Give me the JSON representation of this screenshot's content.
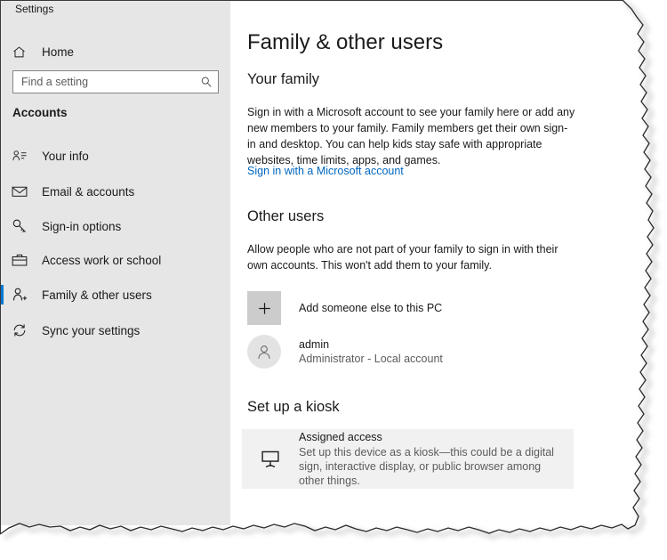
{
  "window": {
    "title": "Settings"
  },
  "sidebar": {
    "home": {
      "label": "Home",
      "icon": "home-icon"
    },
    "search": {
      "placeholder": "Find a setting",
      "value": "",
      "icon": "search-icon"
    },
    "group_label": "Accounts",
    "accent_color": "#0078d4",
    "background_color": "#e6e6e6",
    "items": [
      {
        "label": "Your info",
        "icon": "person-lines-icon",
        "selected": false
      },
      {
        "label": "Email & accounts",
        "icon": "envelope-icon",
        "selected": false
      },
      {
        "label": "Sign-in options",
        "icon": "key-icon",
        "selected": false
      },
      {
        "label": "Access work or school",
        "icon": "briefcase-icon",
        "selected": false
      },
      {
        "label": "Family & other users",
        "icon": "person-add-icon",
        "selected": true
      },
      {
        "label": "Sync your settings",
        "icon": "sync-icon",
        "selected": false
      }
    ]
  },
  "main": {
    "page_title": "Family & other users",
    "sections": {
      "family": {
        "heading": "Your family",
        "paragraph": "Sign in with a Microsoft account to see your family here or add any new members to your family. Family members get their own sign-in and desktop. You can help kids stay safe with appropriate websites, time limits, apps, and games.",
        "link_label": "Sign in with a Microsoft account",
        "link_color": "#0067c0"
      },
      "other_users": {
        "heading": "Other users",
        "paragraph": "Allow people who are not part of your family to sign in with their own accounts. This won't add them to your family.",
        "add_user": {
          "label": "Add someone else to this PC",
          "icon": "plus-icon"
        },
        "accounts": [
          {
            "name": "admin",
            "description": "Administrator - Local account",
            "icon": "person-avatar-icon"
          }
        ]
      },
      "kiosk": {
        "heading": "Set up a kiosk",
        "card": {
          "title": "Assigned access",
          "description": "Set up this device as a kiosk—this could be a digital sign, interactive display, or public browser among other things.",
          "icon": "kiosk-monitor-icon",
          "background_color": "#f1f1f1"
        }
      }
    }
  }
}
